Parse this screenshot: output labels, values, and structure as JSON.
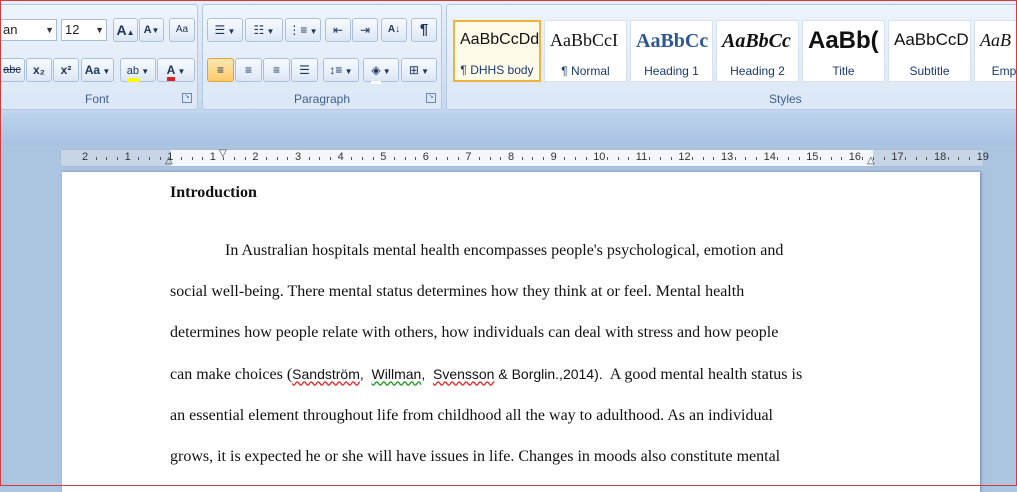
{
  "ribbon": {
    "font_group": {
      "label": "Font",
      "font_name": "an",
      "font_size": "12",
      "grow_label": "A",
      "shrink_label": "A",
      "clear_label": "Aa",
      "strike_label": "abc",
      "sub_label": "x₂",
      "sup_label": "x²",
      "case_label": "Aa",
      "highlight_label": "ab",
      "color_label": "A",
      "highlight_color": "#ffff00",
      "font_color": "#e02020"
    },
    "paragraph_group": {
      "label": "Paragraph"
    },
    "styles_group": {
      "label": "Styles",
      "items": [
        {
          "preview": "AaBbCcDd",
          "name": "¶ DHHS body"
        },
        {
          "preview": "AaBbCcI",
          "name": "¶ Normal"
        },
        {
          "preview": "AaBbCc",
          "name": "Heading 1"
        },
        {
          "preview": "AaBbCc",
          "name": "Heading 2"
        },
        {
          "preview": "AaBb(",
          "name": "Title"
        },
        {
          "preview": "AaBbCcD",
          "name": "Subtitle"
        },
        {
          "preview": "AaB",
          "name": "Emp"
        }
      ]
    }
  },
  "ruler": {
    "numbers": [
      "2",
      "1",
      "1",
      "1",
      "2",
      "3",
      "4",
      "5",
      "6",
      "7",
      "8",
      "9",
      "10",
      "11",
      "12",
      "13",
      "14",
      "15",
      "16",
      "17",
      "18",
      "19"
    ]
  },
  "document": {
    "heading": "Introduction",
    "lines": [
      {
        "text": "In Australian hospitals mental health encompasses people's psychological, emotion and"
      },
      {
        "text": "social well-being. There mental status determines how they think at or feel. Mental health"
      },
      {
        "text": "determines how people relate with others, how individuals can deal with stress and how people"
      },
      {
        "pre": "can make choices (",
        "a1": "Sandström",
        "sep1": ",  ",
        "a2": "Willman",
        "sep2": ",  ",
        "a3": "Svensson",
        "rest": " & Borglin.,2014).",
        "post": "  A good mental health status is"
      },
      {
        "text": "an essential element throughout life from childhood all the way to adulthood. As an individual"
      },
      {
        "text": "grows, it is expected he or she will have issues in life. Changes in moods also constitute mental"
      }
    ]
  }
}
